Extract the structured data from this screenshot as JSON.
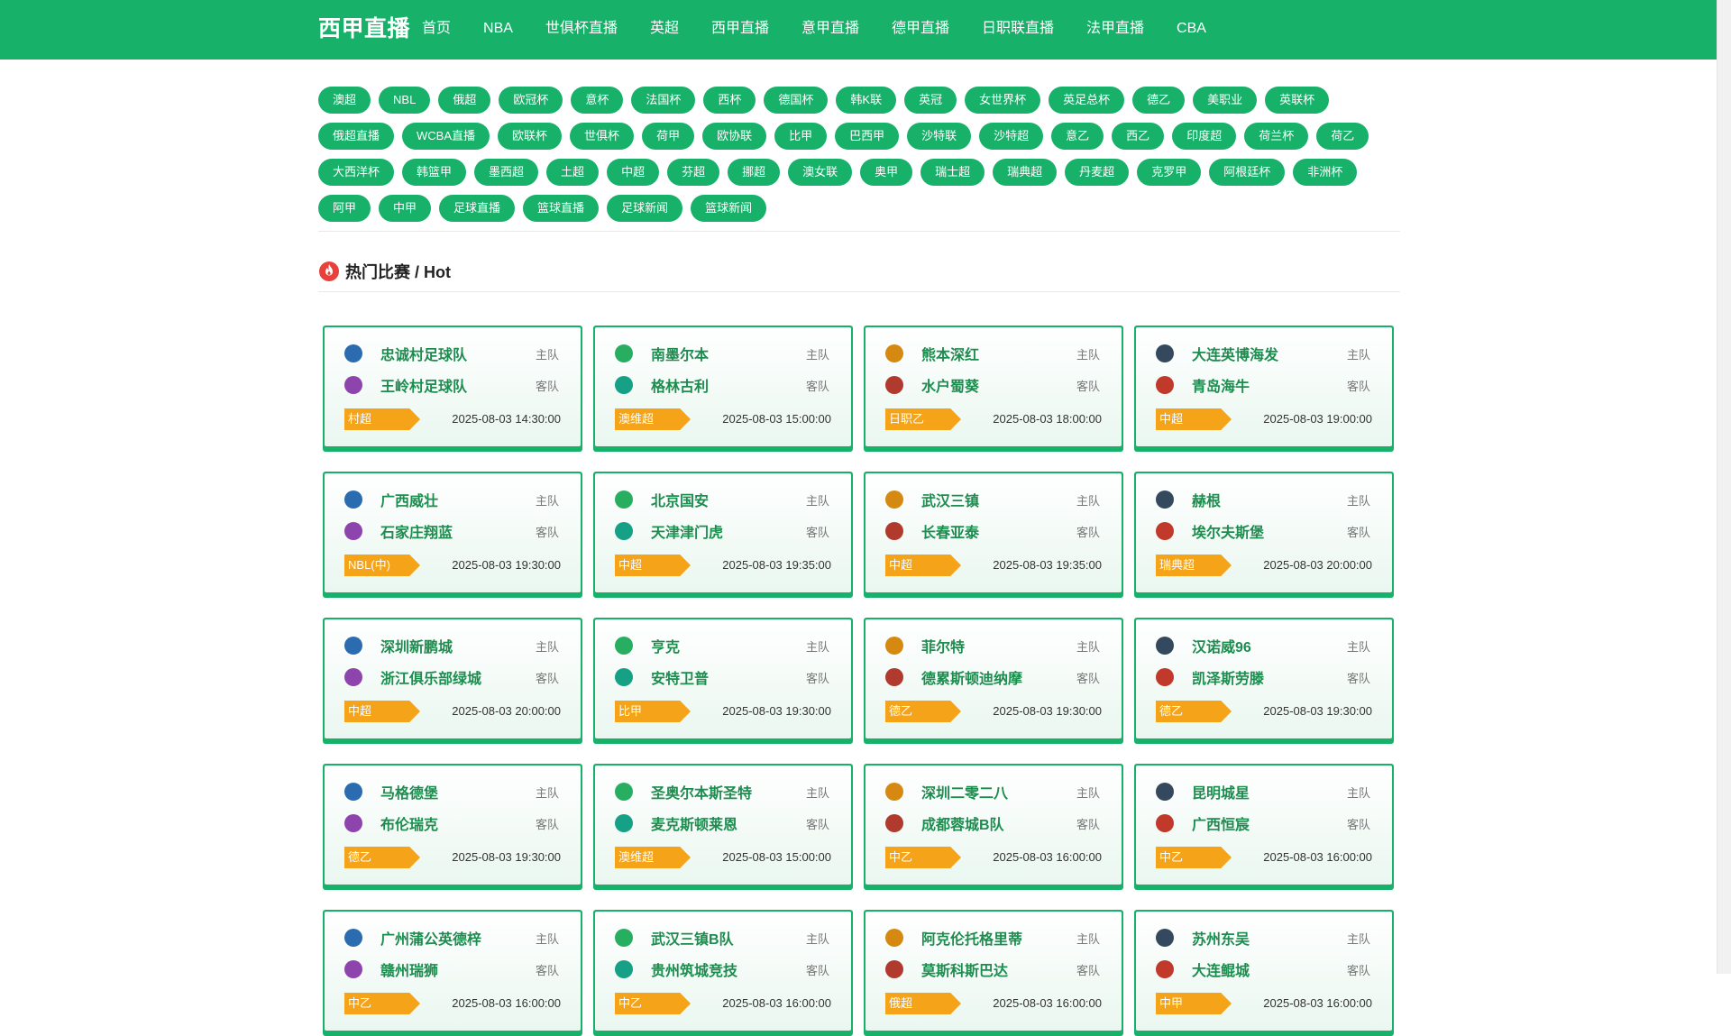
{
  "header": {
    "logo": "西甲直播",
    "nav": [
      "首页",
      "NBA",
      "世俱杯直播",
      "英超",
      "西甲直播",
      "意甲直播",
      "德甲直播",
      "日职联直播",
      "法甲直播",
      "CBA"
    ]
  },
  "tags": [
    "澳超",
    "NBL",
    "俄超",
    "欧冠杯",
    "意杯",
    "法国杯",
    "西杯",
    "德国杯",
    "韩K联",
    "英冠",
    "女世界杯",
    "英足总杯",
    "德乙",
    "美职业",
    "英联杯",
    "俄超直播",
    "WCBA直播",
    "欧联杯",
    "世俱杯",
    "荷甲",
    "欧协联",
    "比甲",
    "巴西甲",
    "沙特联",
    "沙特超",
    "意乙",
    "西乙",
    "印度超",
    "荷兰杯",
    "荷乙",
    "大西洋杯",
    "韩篮甲",
    "墨西超",
    "土超",
    "中超",
    "芬超",
    "挪超",
    "澳女联",
    "奥甲",
    "瑞士超",
    "瑞典超",
    "丹麦超",
    "克罗甲",
    "阿根廷杯",
    "非洲杯",
    "阿甲",
    "中甲",
    "足球直播",
    "篮球直播",
    "足球新闻",
    "篮球新闻"
  ],
  "section": {
    "title": "热门比赛 / Hot"
  },
  "labels": {
    "home": "主队",
    "away": "客队"
  },
  "colors": {
    "brand": "#17b169",
    "league_tag": "#f5a319",
    "team_text": "#1c8d4f"
  },
  "matches": [
    {
      "home": "忠诚村足球队",
      "away": "王岭村足球队",
      "league": "村超",
      "time": "2025-08-03 14:30:00"
    },
    {
      "home": "南墨尔本",
      "away": "格林古利",
      "league": "澳维超",
      "time": "2025-08-03 15:00:00"
    },
    {
      "home": "熊本深红",
      "away": "水户蜀葵",
      "league": "日职乙",
      "time": "2025-08-03 18:00:00"
    },
    {
      "home": "大连英博海发",
      "away": "青岛海牛",
      "league": "中超",
      "time": "2025-08-03 19:00:00"
    },
    {
      "home": "广西威壮",
      "away": "石家庄翔蓝",
      "league": "NBL(中)",
      "time": "2025-08-03 19:30:00"
    },
    {
      "home": "北京国安",
      "away": "天津津门虎",
      "league": "中超",
      "time": "2025-08-03 19:35:00"
    },
    {
      "home": "武汉三镇",
      "away": "长春亚泰",
      "league": "中超",
      "time": "2025-08-03 19:35:00"
    },
    {
      "home": "赫根",
      "away": "埃尔夫斯堡",
      "league": "瑞典超",
      "time": "2025-08-03 20:00:00"
    },
    {
      "home": "深圳新鹏城",
      "away": "浙江俱乐部绿城",
      "league": "中超",
      "time": "2025-08-03 20:00:00"
    },
    {
      "home": "亨克",
      "away": "安特卫普",
      "league": "比甲",
      "time": "2025-08-03 19:30:00"
    },
    {
      "home": "菲尔特",
      "away": "德累斯顿迪纳摩",
      "league": "德乙",
      "time": "2025-08-03 19:30:00"
    },
    {
      "home": "汉诺威96",
      "away": "凯泽斯劳滕",
      "league": "德乙",
      "time": "2025-08-03 19:30:00"
    },
    {
      "home": "马格德堡",
      "away": "布伦瑞克",
      "league": "德乙",
      "time": "2025-08-03 19:30:00"
    },
    {
      "home": "圣奥尔本斯圣特",
      "away": "麦克斯顿莱恩",
      "league": "澳维超",
      "time": "2025-08-03 15:00:00"
    },
    {
      "home": "深圳二零二八",
      "away": "成都蓉城B队",
      "league": "中乙",
      "time": "2025-08-03 16:00:00"
    },
    {
      "home": "昆明城星",
      "away": "广西恒宸",
      "league": "中乙",
      "time": "2025-08-03 16:00:00"
    },
    {
      "home": "广州蒲公英德梓",
      "away": "赣州瑞狮",
      "league": "中乙",
      "time": "2025-08-03 16:00:00"
    },
    {
      "home": "武汉三镇B队",
      "away": "贵州筑城竞技",
      "league": "中乙",
      "time": "2025-08-03 16:00:00"
    },
    {
      "home": "阿克伦托格里蒂",
      "away": "莫斯科斯巴达",
      "league": "俄超",
      "time": "2025-08-03 16:00:00"
    },
    {
      "home": "苏州东吴",
      "away": "大连鲲城",
      "league": "中甲",
      "time": "2025-08-03 16:00:00"
    }
  ]
}
